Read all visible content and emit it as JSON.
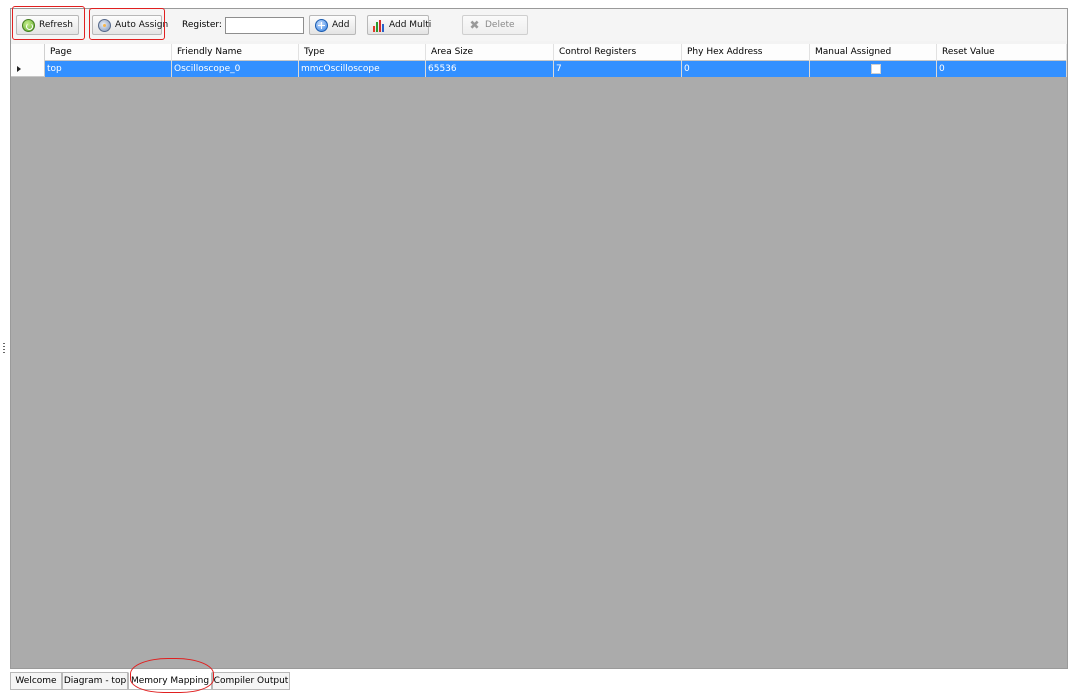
{
  "toolbar": {
    "refresh_label": "Refresh",
    "auto_assign_label": "Auto Assign",
    "register_label": "Register:",
    "register_value": "",
    "add_label": "Add",
    "add_multi_label": "Add Multi",
    "delete_label": "Delete"
  },
  "grid": {
    "columns": [
      "Page",
      "Friendly Name",
      "Type",
      "Area Size",
      "Control Registers",
      "Phy Hex Address",
      "Manual Assigned",
      "Reset Value"
    ],
    "rows": [
      {
        "page": "top",
        "friendly_name": "Oscilloscope_0",
        "type": "mmcOscilloscope",
        "area_size": "65536",
        "control_registers": "7",
        "phy_hex_address": "0",
        "manual_assigned": false,
        "reset_value": "0"
      }
    ]
  },
  "tabs": [
    {
      "label": "Welcome"
    },
    {
      "label": "Diagram - top"
    },
    {
      "label": "Memory Mapping",
      "active": true
    },
    {
      "label": "Compiler Output"
    }
  ],
  "icons": {
    "refresh": "refresh-icon",
    "auto_assign": "gear-icon",
    "add": "plus-circle-icon",
    "add_multi": "bar-chart-icon",
    "delete": "delete-icon"
  },
  "colors": {
    "selection": "#3390ff",
    "grid_background": "#ababab",
    "annotation": "#e02020"
  }
}
